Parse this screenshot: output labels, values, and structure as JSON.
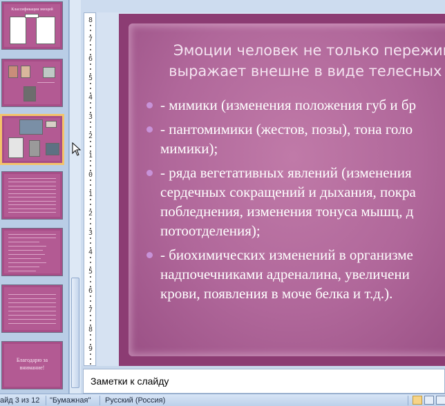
{
  "thumbnails": [
    {
      "id": 2,
      "caption": "Классификация эмоций",
      "kind": "diagram"
    },
    {
      "id": 3,
      "kind": "photos"
    },
    {
      "id": 4,
      "kind": "photos",
      "selected": true
    },
    {
      "id": 5,
      "kind": "text"
    },
    {
      "id": 6,
      "kind": "text"
    },
    {
      "id": 7,
      "kind": "text"
    },
    {
      "id": 8,
      "kind": "text",
      "text": "Благодарю за внимание!"
    }
  ],
  "slide": {
    "title_line1": "Эмоции человек не только пережив",
    "title_line2": "выражает внешне в виде телесных п",
    "bullets": [
      [
        "- мимики (изменения положения губ и бр"
      ],
      [
        "- пантомимики (жестов, позы), тона голо",
        "мимики);"
      ],
      [
        "- ряда вегетативных явлений (изменения",
        "сердечных сокращений и дыхания, покра",
        "побледнения, изменения тонуса мышц, д",
        "потоотделения);"
      ],
      [
        "- биохимических изменений в организме",
        "надпочечниками адреналина, увеличени",
        "крови, появления в моче белка и т.д.)."
      ]
    ]
  },
  "notes": {
    "placeholder": "Заметки к слайду"
  },
  "status": {
    "slide_info": "айд 3 из 12",
    "theme": "\"Бумажная\"",
    "language": "Русский (Россия)"
  },
  "ruler": {
    "ticks": [
      "8",
      "7",
      "6",
      "5",
      "4",
      "3",
      "2",
      "1",
      "0",
      "1",
      "2",
      "3",
      "4",
      "5",
      "6",
      "7",
      "8",
      "9"
    ]
  },
  "colors": {
    "slide_bg": "#8c3c73",
    "paper": "#b0679a",
    "bullet_marker": "#c792d8",
    "selection": "#f4c36a"
  }
}
